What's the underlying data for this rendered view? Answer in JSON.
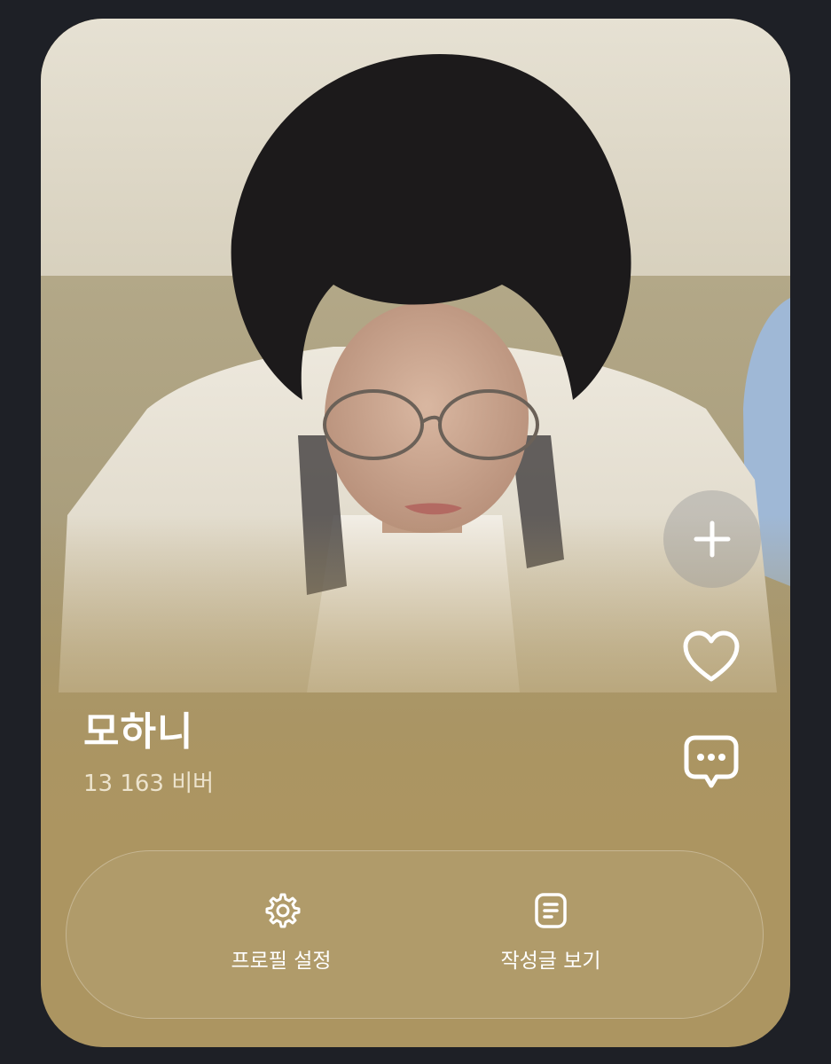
{
  "profile": {
    "name": "모하니",
    "followers": "13 163 비버"
  },
  "side_actions": {
    "add_icon": "plus-icon",
    "like_icon": "heart-icon",
    "message_icon": "chat-bubble-icon"
  },
  "bottom_actions": [
    {
      "label": "프로필 설정",
      "icon": "gear-icon"
    },
    {
      "label": "작성글 보기",
      "icon": "document-icon"
    }
  ],
  "colors": {
    "background": "#1e2026",
    "card": "#ac9561",
    "text_primary": "#ffffff",
    "text_secondary": "#ece3cd"
  }
}
